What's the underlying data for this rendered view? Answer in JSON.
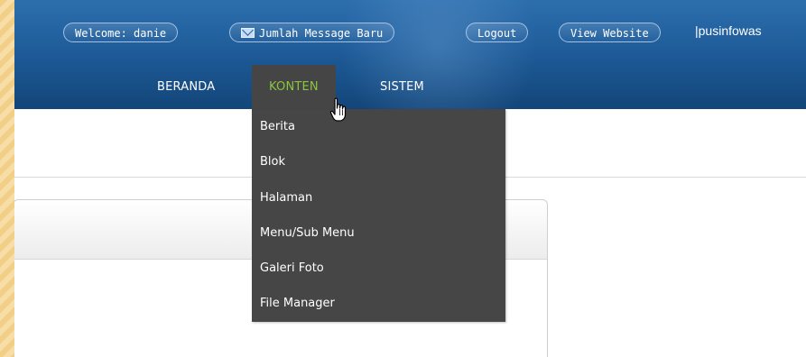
{
  "topbar": {
    "welcome": "Welcome: danie",
    "messages": "Jumlah Message Baru",
    "logout": "Logout",
    "view_website": "View Website",
    "user": "|pusinfowas"
  },
  "nav": {
    "items": [
      {
        "label": "BERANDA"
      },
      {
        "label": "KONTEN"
      },
      {
        "label": "SISTEM"
      }
    ],
    "active_color": "#8bc63e"
  },
  "dropdown": {
    "items": [
      {
        "label": "Berita"
      },
      {
        "label": "Blok"
      },
      {
        "label": "Halaman"
      },
      {
        "label": "Menu/Sub Menu"
      },
      {
        "label": "Galeri Foto"
      },
      {
        "label": "File Manager"
      }
    ]
  },
  "icons": {
    "mail": "envelope-icon",
    "cursor": "hand-pointer-icon"
  }
}
